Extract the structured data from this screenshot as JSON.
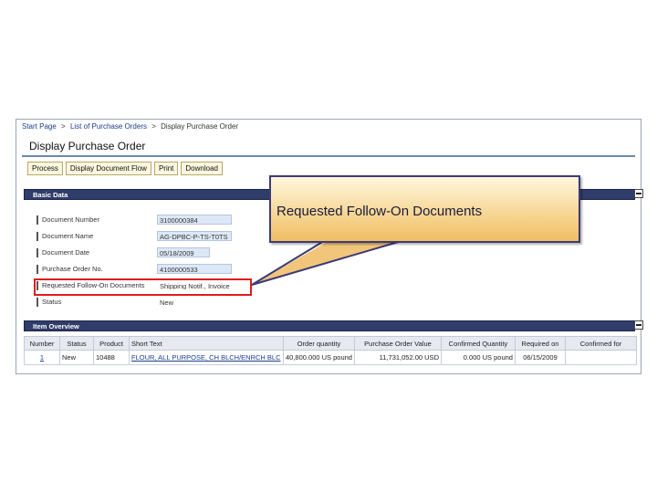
{
  "breadcrumb": {
    "start_page": "Start Page",
    "list": "List of Purchase Orders",
    "current": "Display Purchase Order",
    "separator": ">"
  },
  "page_title": "Display Purchase Order",
  "toolbar": {
    "process": "Process",
    "display_flow": "Display Document Flow",
    "print": "Print",
    "download": "Download"
  },
  "basic_data": {
    "header": "Basic Data",
    "fields": [
      {
        "label": "Document Number",
        "value": "3100000384"
      },
      {
        "label": "Document Name",
        "value": "AG-DPBC-P-TS-T0TS"
      },
      {
        "label": "Document Date",
        "value": "05/18/2009"
      },
      {
        "label": "Purchase Order No.",
        "value": "4100000533"
      },
      {
        "label": "Requested Follow-On Documents",
        "value": "Shipping Notif., Invoice"
      },
      {
        "label": "Status",
        "value": "New"
      }
    ]
  },
  "item_overview": {
    "header": "Item Overview",
    "columns": [
      "Number",
      "Status",
      "Product",
      "Short Text",
      "Order quantity",
      "Purchase Order Value",
      "Confirmed Quantity",
      "Required on",
      "Confirmed for"
    ],
    "rows": [
      [
        "1",
        "New",
        "10488",
        "FLOUR, ALL PURPOSE, CH BLCH/ENRCH BLC",
        "40,800.000 US pound",
        "11,731,052.00 USD",
        "0.000 US pound",
        "06/15/2009",
        ""
      ]
    ]
  },
  "callout": {
    "text": "Requested Follow-On Documents"
  },
  "colors": {
    "section_header": "#303d6a",
    "highlight": "#e01c1c",
    "callout_border": "#3d3b78",
    "callout_fill": "#f5cf86"
  }
}
